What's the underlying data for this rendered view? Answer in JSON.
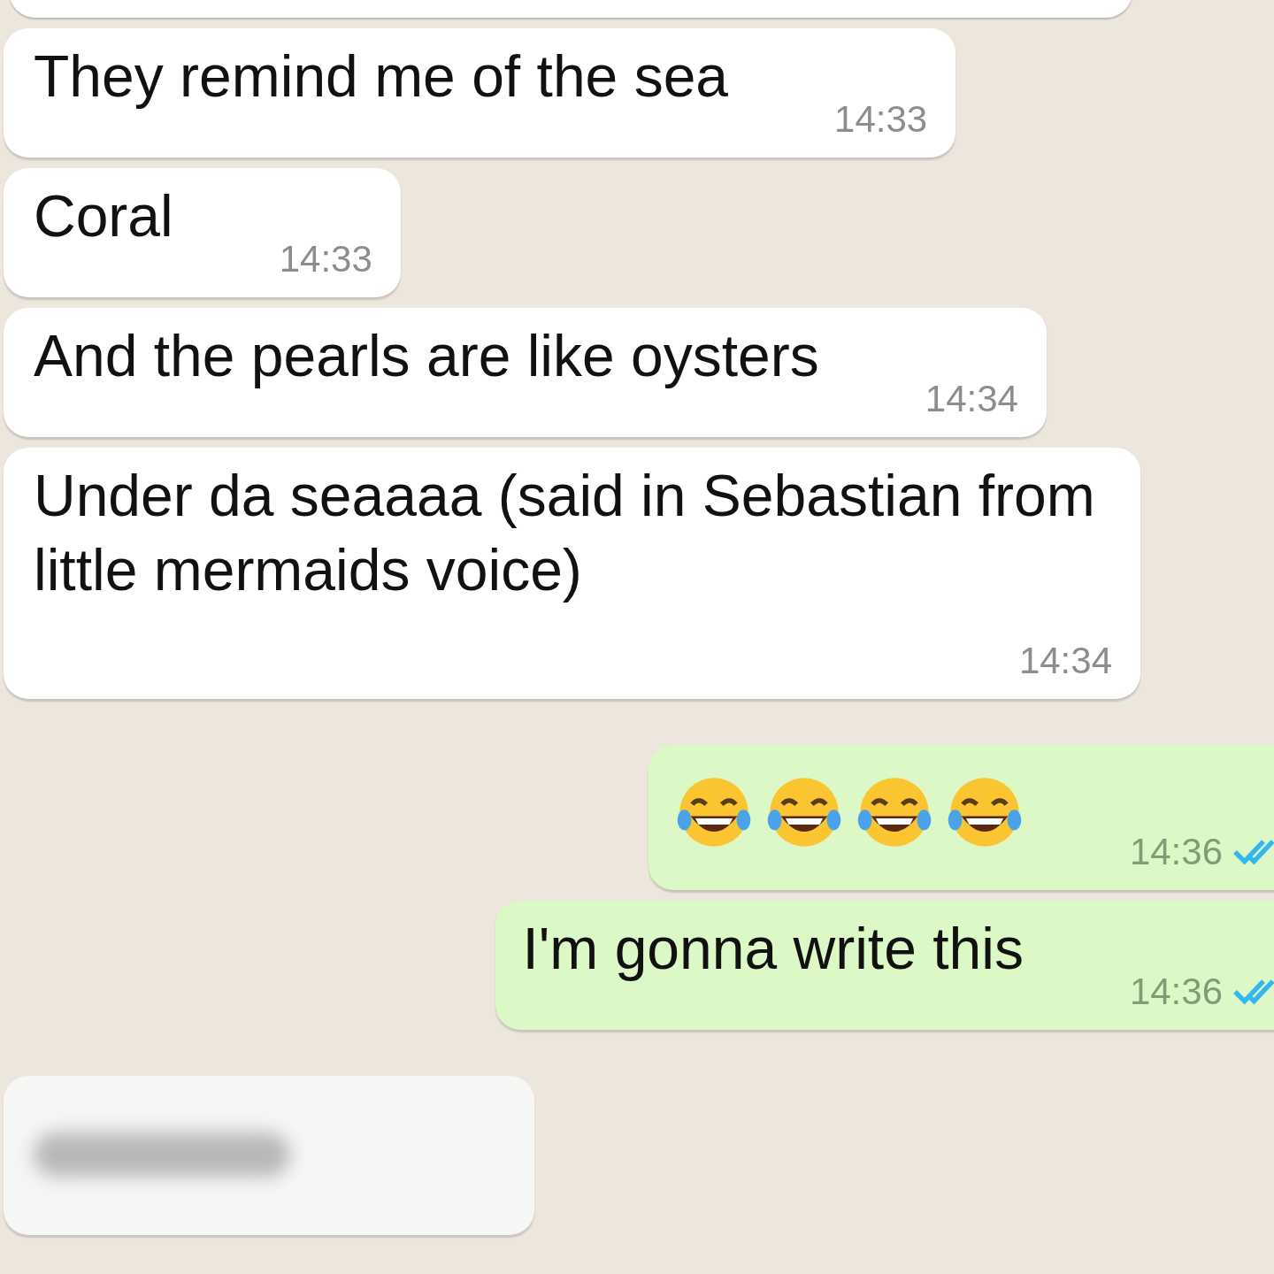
{
  "messages": [
    {
      "kind": "incoming",
      "text": "They remind me of the sea",
      "time": "14:33"
    },
    {
      "kind": "incoming",
      "text": "Coral",
      "time": "14:33"
    },
    {
      "kind": "incoming",
      "text": "And the pearls are like oysters",
      "time": "14:34"
    },
    {
      "kind": "incoming",
      "text": "Under da seaaaa (said in Sebastian from little mermaids voice)",
      "time": "14:34"
    },
    {
      "kind": "outgoing",
      "time": "14:36",
      "read": true
    },
    {
      "kind": "outgoing",
      "text": "I'm gonna write this",
      "time": "14:36",
      "read": true
    },
    {
      "kind": "blurred"
    }
  ]
}
